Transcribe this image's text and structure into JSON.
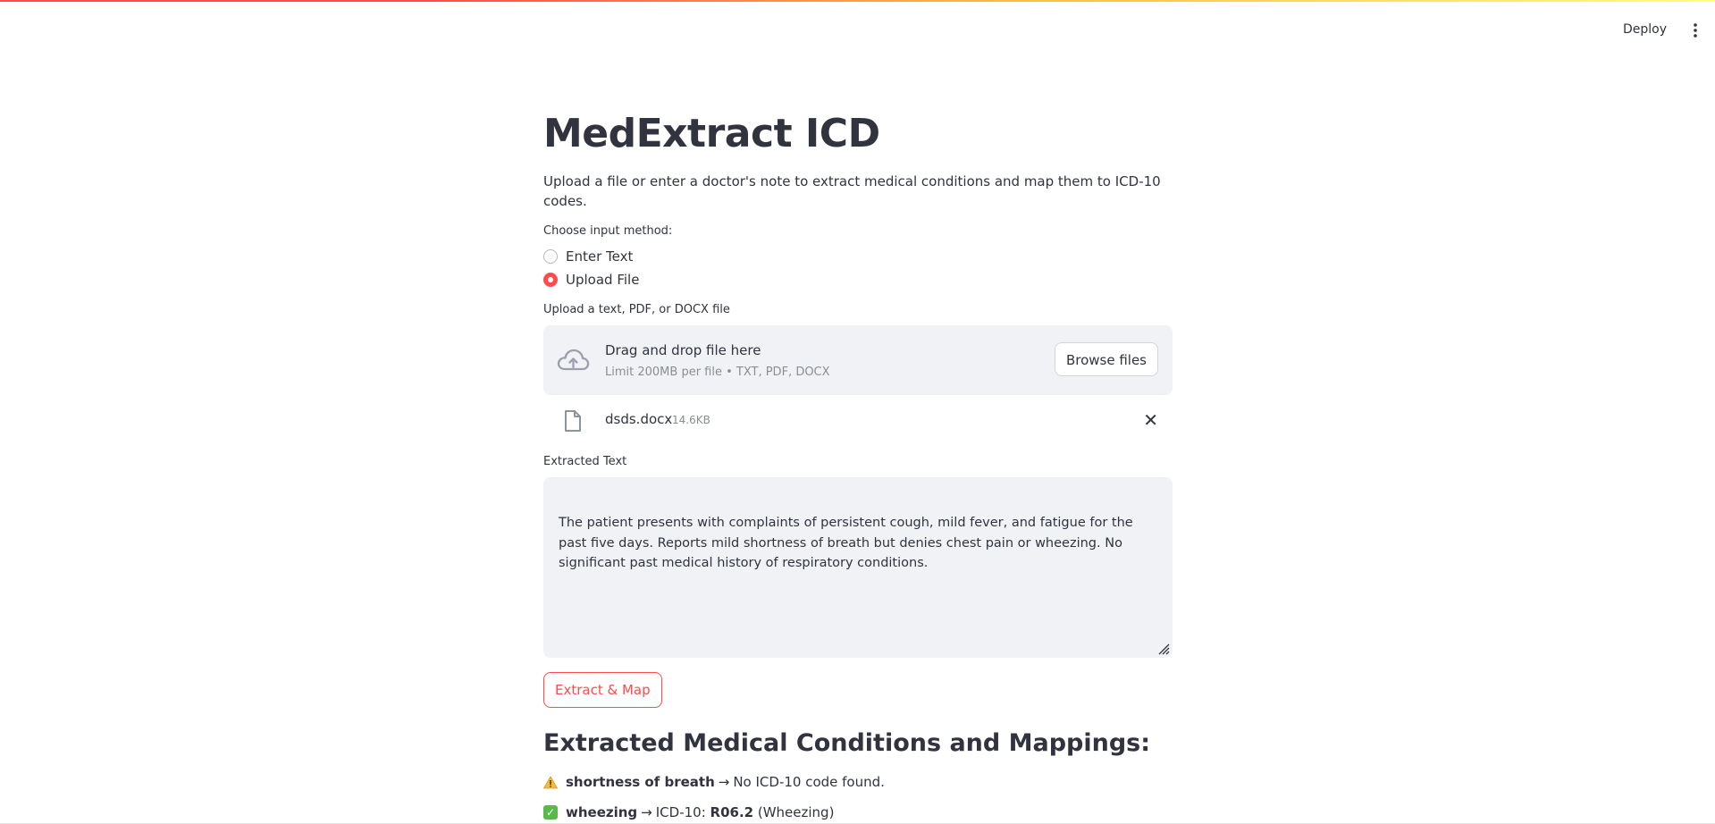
{
  "header": {
    "deploy_label": "Deploy",
    "menu_icon": "kebab-menu-icon"
  },
  "app": {
    "title": "MedExtract ICD",
    "subtitle": "Upload a file or enter a doctor's note to extract medical conditions and map them to ICD-10 codes."
  },
  "input_method": {
    "label": "Choose input method:",
    "options": [
      "Enter Text",
      "Upload File"
    ],
    "selected": "Upload File"
  },
  "uploader": {
    "label": "Upload a text, PDF, or DOCX file",
    "drag_text": "Drag and drop file here",
    "limit_text": "Limit 200MB per file • TXT, PDF, DOCX",
    "browse_label": "Browse files",
    "file": {
      "name": "dsds.docx",
      "size": "14.6KB"
    }
  },
  "extracted": {
    "label": "Extracted Text",
    "text": "The patient presents with complaints of persistent cough, mild fever, and fatigue for the past five days. Reports mild shortness of breath but denies chest pain or wheezing. No significant past medical history of respiratory conditions."
  },
  "actions": {
    "extract_label": "Extract & Map"
  },
  "results": {
    "heading": "Extracted Medical Conditions and Mappings:",
    "items": [
      {
        "condition": "shortness of breath",
        "arrow": "→",
        "text": "No ICD-10 code found.",
        "status": "warning"
      },
      {
        "condition": "wheezing",
        "arrow": "→",
        "prefix": "ICD-10: ",
        "code": "R06.2",
        "suffix": " (Wheezing)",
        "status": "success"
      }
    ]
  },
  "colors": {
    "accent": "#ff4b4b",
    "panel": "#f0f2f6",
    "text": "#31333f"
  }
}
